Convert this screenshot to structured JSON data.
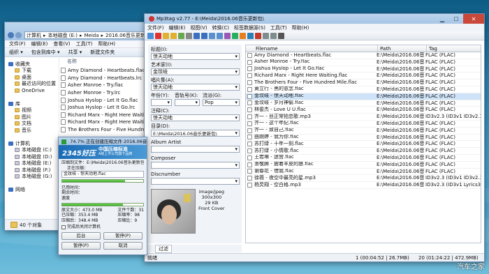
{
  "explorer": {
    "breadcrumb": [
      "计算机",
      "本地磁盘 (E:)",
      "Meida",
      "2016.06音乐更新"
    ],
    "menu": [
      "文件(F)",
      "编辑(E)",
      "查看(V)",
      "工具(T)",
      "帮助(H)"
    ],
    "toolbar": [
      "组织 ▾",
      "包含到库中 ▾",
      "共享 ▾",
      "新建文件夹"
    ],
    "nav": [
      {
        "label": "收藏夹",
        "indent": 0
      },
      {
        "label": "下载",
        "indent": 1
      },
      {
        "label": "桌面",
        "indent": 1
      },
      {
        "label": "最近访问的位置",
        "indent": 1
      },
      {
        "label": "OneDrive",
        "indent": 1
      },
      {
        "label": "",
        "indent": 0
      },
      {
        "label": "库",
        "indent": 0
      },
      {
        "label": "视频",
        "indent": 1
      },
      {
        "label": "图片",
        "indent": 1
      },
      {
        "label": "文档",
        "indent": 1
      },
      {
        "label": "音乐",
        "indent": 1
      },
      {
        "label": "",
        "indent": 0
      },
      {
        "label": "计算机",
        "indent": 0
      },
      {
        "label": "本地磁盘 (C:)",
        "indent": 1
      },
      {
        "label": "本地磁盘 (D:)",
        "indent": 1
      },
      {
        "label": "本地磁盘 (E:)",
        "indent": 1
      },
      {
        "label": "本地磁盘 (F:)",
        "indent": 1
      },
      {
        "label": "本地磁盘 (G:)",
        "indent": 1
      },
      {
        "label": "",
        "indent": 0
      },
      {
        "label": "网络",
        "indent": 0
      }
    ],
    "column_header": "名称",
    "files": [
      "Amy Diamond - Heartbeats.flac",
      "Amy Diamond - Heartbeats.lrc",
      "Asher Monroe - Try.flac",
      "Asher Monroe - Try.lrc",
      "Joshua Hyslop - Let It Go.flac",
      "Joshua Hyslop - Let It Go.lrc",
      "Richard Marx - Right Here Waiting.fla",
      "Richard Marx - Right Here Waiting.lrc",
      "The Brothers Four - Five Hundred Mi"
    ],
    "status": "40 个对象"
  },
  "mp3tag": {
    "title": "Mp3tag v2.77  -  E:\\Meida\\2016.06音乐更新包\\",
    "menu": [
      "文件(F)",
      "编辑(E)",
      "视图(V)",
      "转换(C)",
      "标签数据源(S)",
      "工具(T)",
      "帮助(H)"
    ],
    "tag_panel": {
      "labels": [
        "标题(I):",
        "艺术家(I):",
        "唱片集(A):",
        "年份(Y):",
        "音轨号(K):",
        "流派(G):",
        "注释(C):",
        "目录(D):",
        "Album Artist",
        "Composer",
        "Discnumber"
      ],
      "title": "惊天动地",
      "artist": "金玟岐",
      "album": "惊天动地",
      "year": "",
      "track": "",
      "genre": "Pop",
      "comment": "惊天动地",
      "directory": "E:\\Meida\\2016.06音乐更新包\\",
      "album_artist": "",
      "composer": "",
      "discnumber": "",
      "art_info": [
        "image/jpeg",
        "300x300",
        "29 KB",
        "Front Cover"
      ]
    },
    "columns": [
      "Filename",
      "Path",
      "Tag"
    ],
    "rows": [
      {
        "filename": "Amy Diamond - Heartbeats.flac",
        "path": "E:\\Meida\\2016.06音乐...",
        "tag": "FLAC (FLAC)",
        "selected": false
      },
      {
        "filename": "Asher Monroe - Try.flac",
        "path": "E:\\Meida\\2016.06音乐...",
        "tag": "FLAC (FLAC)",
        "selected": false
      },
      {
        "filename": "Joshua Hyslop - Let It Go.flac",
        "path": "E:\\Meida\\2016.06音乐...",
        "tag": "FLAC (FLAC)",
        "selected": false
      },
      {
        "filename": "Richard Marx - Right Here Waiting.flac",
        "path": "E:\\Meida\\2016.06音乐...",
        "tag": "FLAC (FLAC)",
        "selected": false
      },
      {
        "filename": "The Brothers Four - Five Hundred Mile.flac",
        "path": "E:\\Meida\\2016.06音乐...",
        "tag": "FLAC (FLAC)",
        "selected": false
      },
      {
        "filename": "黄立行 - 黑的意念.flac",
        "path": "E:\\Meida\\2016.06音乐...",
        "tag": "FLAC (FLAC)",
        "selected": false
      },
      {
        "filename": "金玟岐 - 惊天动地.flac",
        "path": "E:\\Meida\\2016.06音乐...",
        "tag": "FLAC (FLAC)",
        "selected": true
      },
      {
        "filename": "金玟岐 - 岁月神偷.flac",
        "path": "E:\\Meida\\2016.06音乐...",
        "tag": "FLAC (FLAC)",
        "selected": false
      },
      {
        "filename": "林俊杰 - Love U U.flac",
        "path": "E:\\Meida\\2016.06音乐...",
        "tag": "FLAC (FLAC)",
        "selected": false
      },
      {
        "filename": "齐一 - 丝正常拍恋歌.mp3",
        "path": "E:\\Meida\\2016.06音乐...",
        "tag": "ID3v2.3 (ID3v1 ID3v2.3)",
        "selected": false
      },
      {
        "filename": "齐一 - 这个年纪.flac",
        "path": "E:\\Meida\\2016.06音乐...",
        "tag": "FLAC (FLAC)",
        "selected": false
      },
      {
        "filename": "齐一 - 致自己.flac",
        "path": "E:\\Meida\\2016.06音乐...",
        "tag": "FLAC (FLAC)",
        "selected": false
      },
      {
        "filename": "曲婉婷 - 我为你.flac",
        "path": "E:\\Meida\\2016.06音乐...",
        "tag": "FLAC (FLAC)",
        "selected": false
      },
      {
        "filename": "苏打绿 - 十年一刻.flac",
        "path": "E:\\Meida\\2016.06音乐...",
        "tag": "FLAC (FLAC)",
        "selected": false
      },
      {
        "filename": "苏打绿 - 小情歌.flac",
        "path": "E:\\Meida\\2016.06音乐...",
        "tag": "FLAC (FLAC)",
        "selected": false
      },
      {
        "filename": "王若琳 - 迷宫.flac",
        "path": "E:\\Meida\\2016.06音乐...",
        "tag": "FLAC (FLAC)",
        "selected": false
      },
      {
        "filename": "萧敬腾 - 披着羊皮的狼.flac",
        "path": "E:\\Meida\\2016.06音乐...",
        "tag": "FLAC (FLAC)",
        "selected": false
      },
      {
        "filename": "谢春花 - 借我.flac",
        "path": "E:\\Meida\\2016.06音乐...",
        "tag": "FLAC (FLAC)",
        "selected": false
      },
      {
        "filename": "徐薇 - 夜空中最亮的星.mp3",
        "path": "E:\\Meida\\2016.06音乐...",
        "tag": "ID3v2.3 (ID3v1 ID3v2.3)",
        "selected": false
      },
      {
        "filename": "杨炅翔 - 空白格.mp3",
        "path": "E:\\Meida\\2016.06音乐...",
        "tag": "ID3v2.3 (ID3v1 Lyrics3v",
        "selected": false
      }
    ],
    "filter_label": "过滤",
    "status_left": "就绪",
    "status_mid": "1 (00:04:52 | 26.7MB)",
    "status_right": "20 (01:24:22 | 472.9MB)"
  },
  "compressor": {
    "title": "74.7% 正在创建压缩文件 2016.06音乐更新包...",
    "brand": "2345好压",
    "brand_sub": "中国压缩标准",
    "brand_note": "A级上市公司旗下品牌",
    "label_create": "压缩到文件：E:\\Meida\\2016.06音乐更新包.z",
    "label_compressing": "正在压缩：",
    "current_file": "金玟岐 - 惊天动地.flac",
    "progress_file": 0.78,
    "progress_total": 0.747,
    "elapsed_label": "已用时间：",
    "remaining_label": "剩余时间：",
    "speed_label": "速度",
    "size_label": "原文大小：",
    "size_val": "473.0 MB",
    "compressed_label": "已压缩：",
    "compressed_val": "353.4 MB",
    "packed_label": "压缩后：",
    "packed_val": "348.4 MB",
    "count_label": "文件个数：",
    "count_val": "31",
    "ratio_label": "压缩率：",
    "ratio_val": "98",
    "left_label": "压缩比：",
    "left_val": "9",
    "shutdown_label": "完成后关闭计算机",
    "btn_background": "后台",
    "btn_pause": "暂停(P)",
    "btn_close": "暂停(P)",
    "btn_advanced": "取消"
  },
  "watermark": "汽车之家"
}
